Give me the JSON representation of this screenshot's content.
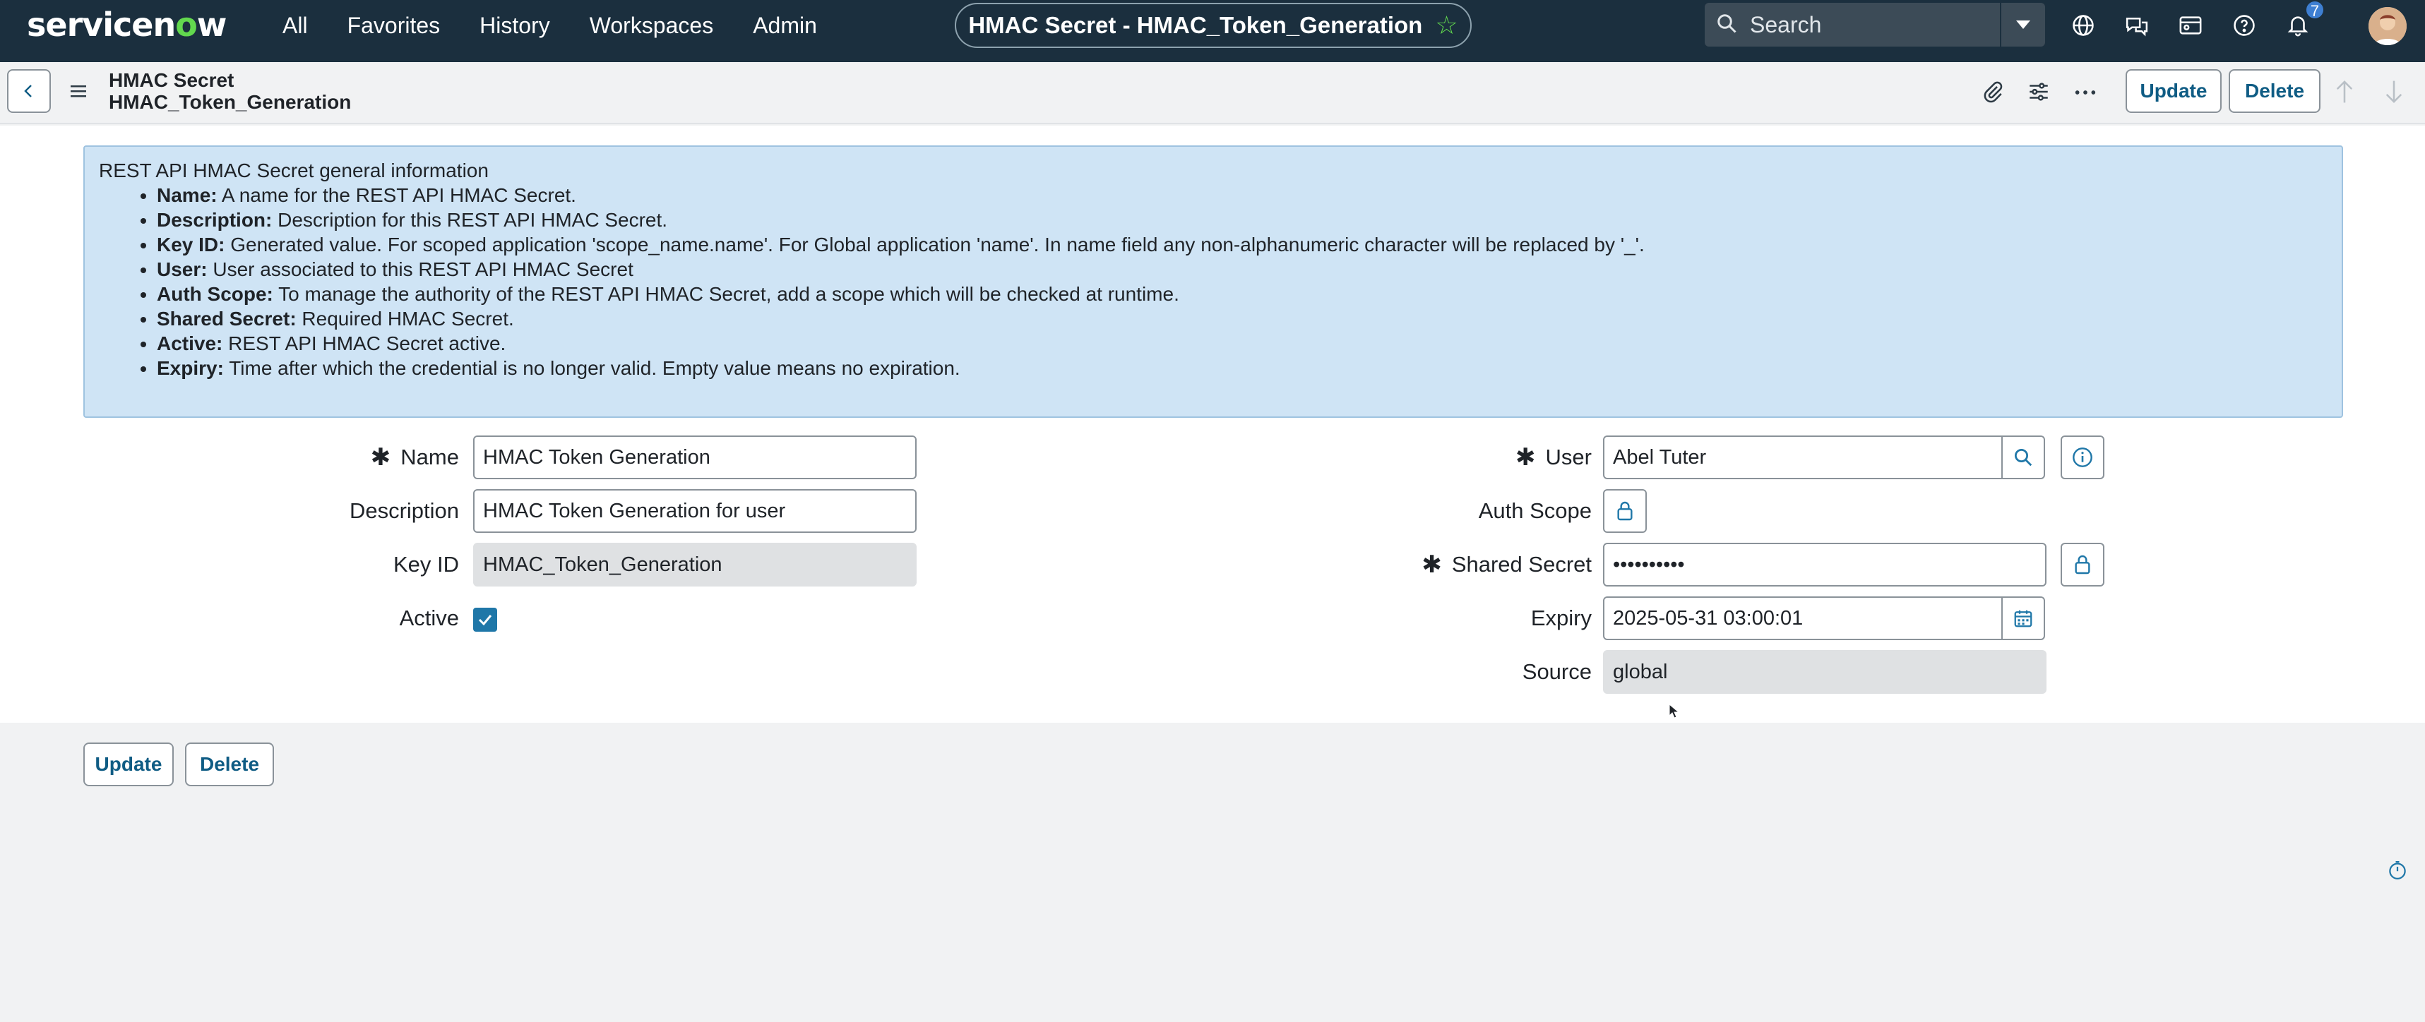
{
  "topbar": {
    "logo_text": "servicenow",
    "menu": [
      "All",
      "Favorites",
      "History",
      "Workspaces",
      "Admin"
    ],
    "page_title": "HMAC Secret - HMAC_Token_Generation",
    "search_placeholder": "Search",
    "notification_count": "7",
    "icons": [
      "globe-icon",
      "chat-icon",
      "card-icon",
      "help-icon",
      "bell-icon"
    ]
  },
  "header": {
    "record_type": "HMAC Secret",
    "record_name": "HMAC_Token_Generation",
    "update_label": "Update",
    "delete_label": "Delete"
  },
  "info": {
    "title": "REST API HMAC Secret general information",
    "items": [
      {
        "term": "Name:",
        "desc": " A name for the REST API HMAC Secret."
      },
      {
        "term": "Description:",
        "desc": " Description for this REST API HMAC Secret."
      },
      {
        "term": "Key ID:",
        "desc": " Generated value. For scoped application 'scope_name.name'. For Global application 'name'. In name field any non-alphanumeric character will be replaced by '_'."
      },
      {
        "term": "User:",
        "desc": " User associated to this REST API HMAC Secret"
      },
      {
        "term": "Auth Scope:",
        "desc": " To manage the authority of the REST API HMAC Secret, add a scope which will be checked at runtime."
      },
      {
        "term": "Shared Secret:",
        "desc": " Required HMAC Secret."
      },
      {
        "term": "Active:",
        "desc": " REST API HMAC Secret active."
      },
      {
        "term": "Expiry:",
        "desc": " Time after which the credential is no longer valid. Empty value means no expiration."
      }
    ]
  },
  "form": {
    "name_label": "Name",
    "name_value": "HMAC Token Generation",
    "description_label": "Description",
    "description_value": "HMAC Token Generation for user",
    "keyid_label": "Key ID",
    "keyid_value": "HMAC_Token_Generation",
    "active_label": "Active",
    "active_checked": true,
    "user_label": "User",
    "user_value": "Abel Tuter",
    "authscope_label": "Auth Scope",
    "secret_label": "Shared Secret",
    "secret_value": "••••••••••",
    "expiry_label": "Expiry",
    "expiry_value": "2025-05-31 03:00:01",
    "source_label": "Source",
    "source_value": "global",
    "required_marker": "✱"
  },
  "footer": {
    "update_label": "Update",
    "delete_label": "Delete"
  },
  "colors": {
    "topbar": "#1b2f3e",
    "accent_green": "#62d84e",
    "info_bg": "#cfe4f5",
    "button_text": "#0f5c84"
  }
}
